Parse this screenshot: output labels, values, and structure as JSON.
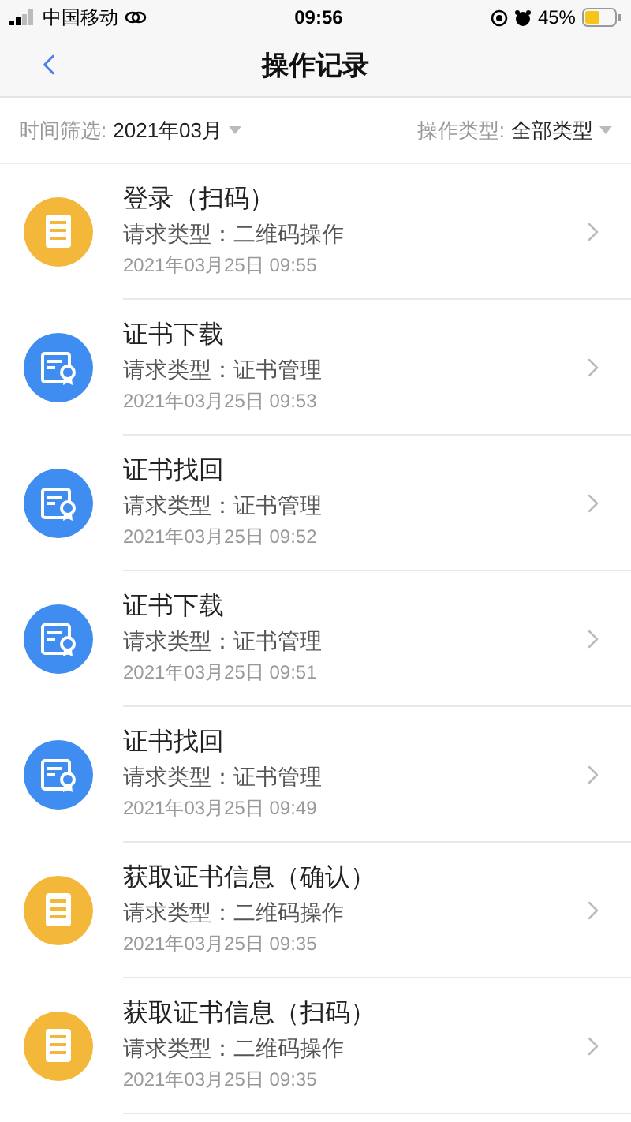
{
  "status_bar": {
    "carrier": "中国移动",
    "time": "09:56",
    "battery": "45%"
  },
  "header": {
    "title": "操作记录"
  },
  "filters": [
    {
      "label": "时间筛选:",
      "value": "2021年03月"
    },
    {
      "label": "操作类型:",
      "value": "全部类型"
    }
  ],
  "records": [
    {
      "kind": "document",
      "title": "登录（扫码）",
      "request_type": "请求类型：二维码操作",
      "time": "2021年03月25日 09:55"
    },
    {
      "kind": "certificate",
      "title": "证书下载",
      "request_type": "请求类型：证书管理",
      "time": "2021年03月25日 09:53"
    },
    {
      "kind": "certificate",
      "title": "证书找回",
      "request_type": "请求类型：证书管理",
      "time": "2021年03月25日 09:52"
    },
    {
      "kind": "certificate",
      "title": "证书下载",
      "request_type": "请求类型：证书管理",
      "time": "2021年03月25日 09:51"
    },
    {
      "kind": "certificate",
      "title": "证书找回",
      "request_type": "请求类型：证书管理",
      "time": "2021年03月25日 09:49"
    },
    {
      "kind": "document",
      "title": "获取证书信息（确认）",
      "request_type": "请求类型：二维码操作",
      "time": "2021年03月25日 09:35"
    },
    {
      "kind": "document",
      "title": "获取证书信息（扫码）",
      "request_type": "请求类型：二维码操作",
      "time": "2021年03月25日 09:35"
    }
  ]
}
